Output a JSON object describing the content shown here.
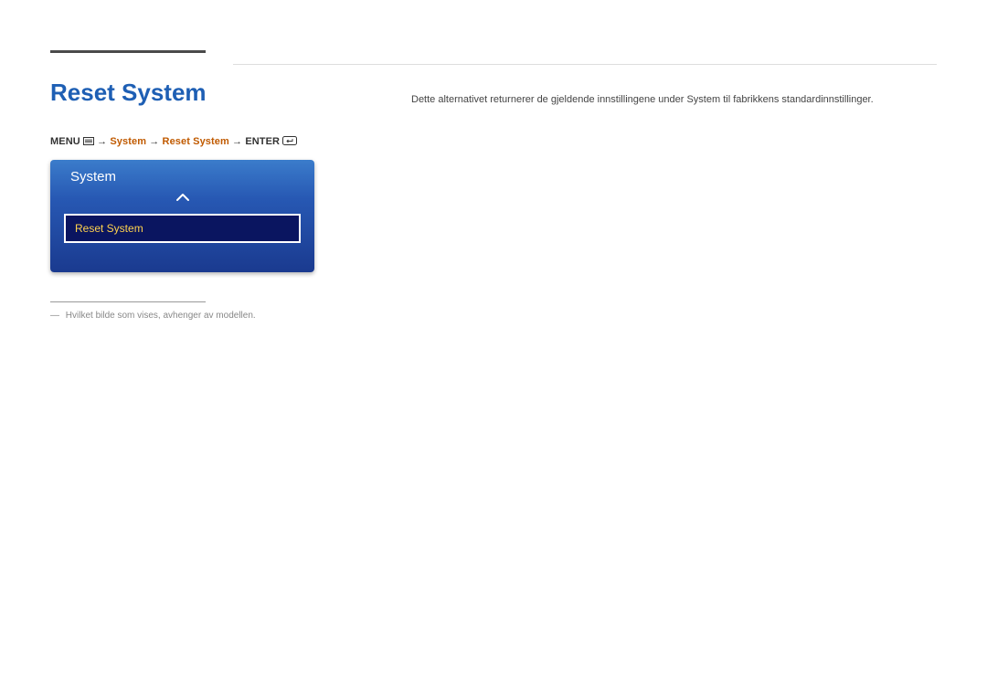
{
  "heading": "Reset System",
  "breadcrumb": {
    "menu_label": "MENU",
    "arrow": "→",
    "system_label": "System",
    "reset_label": "Reset System",
    "enter_label": "ENTER"
  },
  "osd": {
    "panel_title": "System",
    "selected_item": "Reset System"
  },
  "footnote": "Hvilket bilde som vises, avhenger av modellen.",
  "description": "Dette alternativet returnerer de gjeldende innstillingene under System til fabrikkens standardinnstillinger."
}
